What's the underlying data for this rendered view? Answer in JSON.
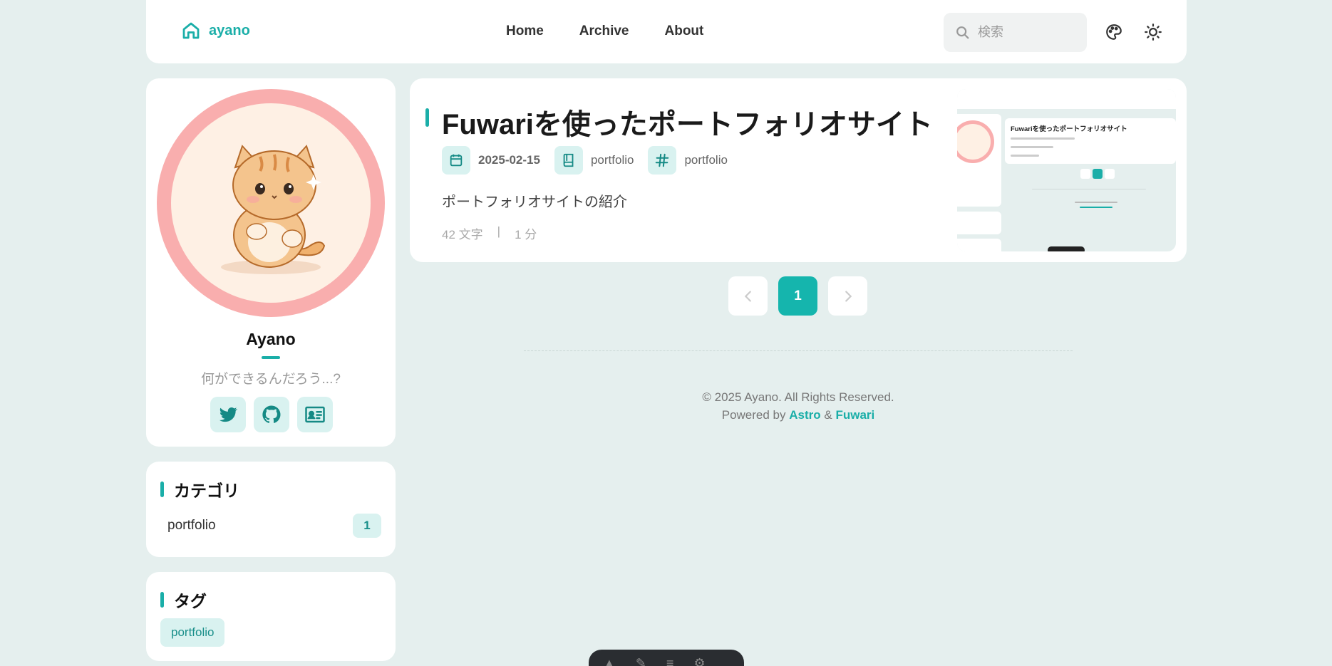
{
  "nav": {
    "brand": "ayano",
    "links": [
      "Home",
      "Archive",
      "About"
    ],
    "search_placeholder": "検索"
  },
  "profile": {
    "name": "Ayano",
    "bio": "何ができるんだろう...?",
    "socials": [
      "twitter-icon",
      "github-icon",
      "id-card-icon"
    ]
  },
  "categories": {
    "title": "カテゴリ",
    "items": [
      {
        "label": "portfolio",
        "count": "1"
      }
    ]
  },
  "tags": {
    "title": "タグ",
    "items": [
      "portfolio"
    ]
  },
  "post": {
    "title": "Fuwariを使ったポートフォリオサイト",
    "date": "2025-02-15",
    "category": "portfolio",
    "tag": "portfolio",
    "description": "ポートフォリオサイトの紹介",
    "word_count": "42 文字",
    "separator": "|",
    "read_time": "1 分"
  },
  "pagination": {
    "current": "1"
  },
  "footer": {
    "copyright": "© 2025 Ayano. All Rights Reserved.",
    "powered_prefix": "Powered by",
    "astro": "Astro",
    "amp": "&",
    "fuwari": "Fuwari"
  },
  "colors": {
    "accent": "#1aaea8",
    "background": "#e5efee",
    "avatar_ring": "#f9aeae"
  }
}
